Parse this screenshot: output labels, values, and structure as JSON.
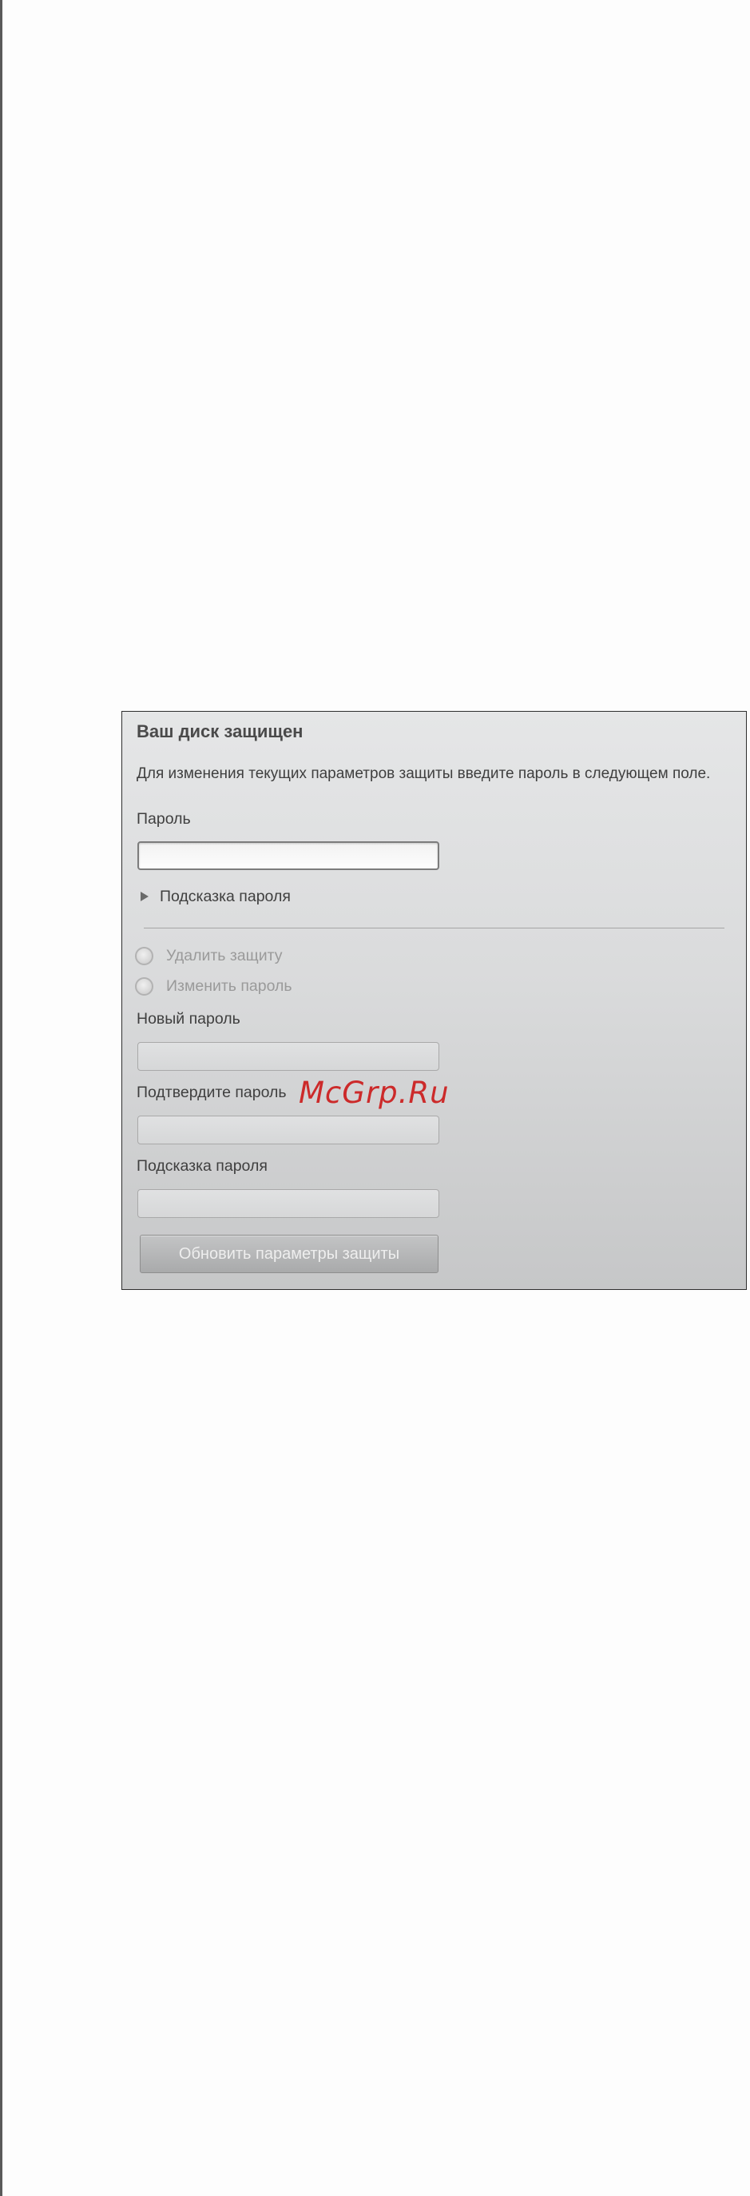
{
  "panel": {
    "title": "Ваш диск защищен",
    "description": "Для изменения текущих параметров защиты введите пароль в следующем поле.",
    "password_label": "Пароль",
    "password_value": "",
    "hint_toggle_label": "Подсказка пароля",
    "radio_options": [
      {
        "label": "Удалить защиту",
        "selected": false,
        "enabled": false
      },
      {
        "label": "Изменить пароль",
        "selected": false,
        "enabled": false
      }
    ],
    "new_password_label": "Новый пароль",
    "new_password_value": "",
    "confirm_password_label": "Подтвердите пароль",
    "confirm_password_value": "",
    "password_hint_label": "Подсказка пароля",
    "password_hint_value": "",
    "update_button_label": "Обновить параметры защиты"
  },
  "watermark": {
    "text": "McGrp.Ru"
  },
  "colors": {
    "page_background": "#fdfdfd",
    "panel_gradient_top": "#e5e6e7",
    "panel_gradient_bottom": "#c6c7c8",
    "panel_border": "#2e2e2e",
    "watermark": "#cc2a2a",
    "disabled_text": "#9a9a9a"
  },
  "icons": {
    "hint_toggle": "triangle-right-icon",
    "radio": "radio-circle-icon"
  }
}
